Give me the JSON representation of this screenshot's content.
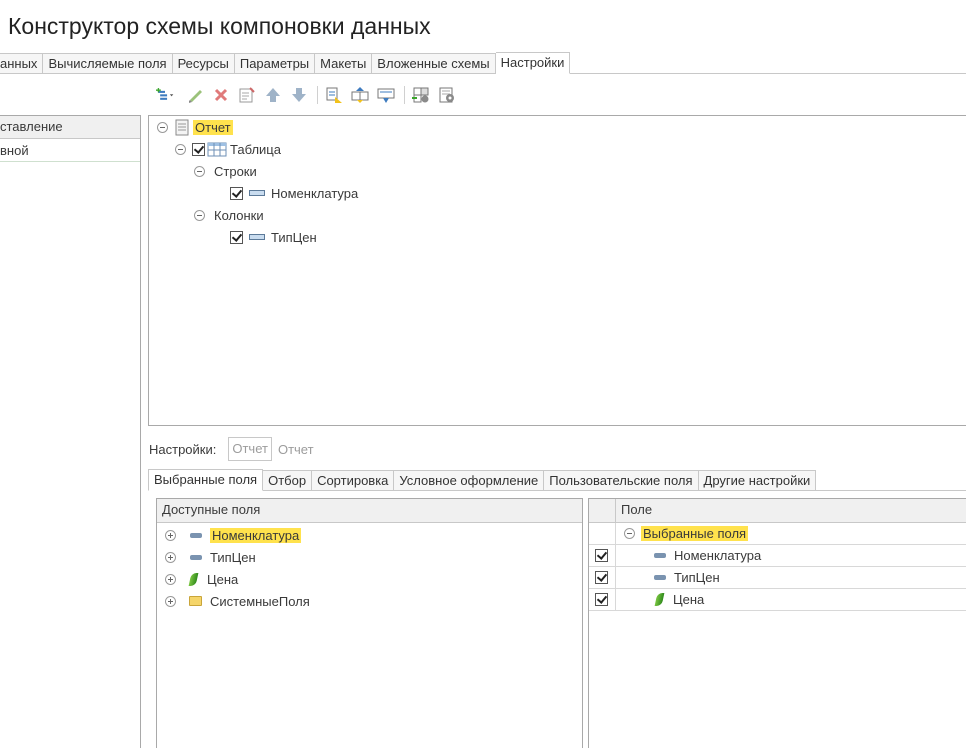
{
  "window": {
    "title": "Конструктор схемы компоновки данных"
  },
  "top_tabs": [
    {
      "label": "анных"
    },
    {
      "label": "Вычисляемые поля"
    },
    {
      "label": "Ресурсы"
    },
    {
      "label": "Параметры"
    },
    {
      "label": "Макеты"
    },
    {
      "label": "Вложенные схемы"
    },
    {
      "label": "Настройки",
      "active": true
    }
  ],
  "toolbar": {
    "icons": [
      "add-element-icon",
      "edit-icon",
      "delete-icon",
      "properties-icon",
      "move-up-icon",
      "move-down-icon",
      "group-1-icon",
      "group-2-icon",
      "group-3-icon",
      "settings-1-icon",
      "settings-2-icon"
    ]
  },
  "left_panel": {
    "header": "ставление",
    "rows": [
      {
        "label": "вной"
      }
    ]
  },
  "structure_tree": {
    "nodes": [
      {
        "label": "Отчет",
        "highlight": true
      },
      {
        "label": "Таблица",
        "checked": true
      },
      {
        "label": "Строки"
      },
      {
        "label": "Номенклатура",
        "checked": true
      },
      {
        "label": "Колонки"
      },
      {
        "label": "ТипЦен",
        "checked": true
      }
    ]
  },
  "settings_line": {
    "label": "Настройки:",
    "button": "Отчет",
    "value": "Отчет"
  },
  "bottom_tabs": [
    {
      "label": "Выбранные поля",
      "active": true
    },
    {
      "label": "Отбор"
    },
    {
      "label": "Сортировка"
    },
    {
      "label": "Условное оформление"
    },
    {
      "label": "Пользовательские поля"
    },
    {
      "label": "Другие настройки"
    }
  ],
  "available_fields": {
    "header": "Доступные поля",
    "items": [
      {
        "label": "Номенклатура",
        "icon": "field-icon",
        "highlight": true
      },
      {
        "label": "ТипЦен",
        "icon": "field-icon"
      },
      {
        "label": "Цена",
        "icon": "resource-icon"
      },
      {
        "label": "СистемныеПоля",
        "icon": "folder-icon"
      }
    ]
  },
  "selected_fields": {
    "header": "Поле",
    "group": "Выбранные поля",
    "items": [
      {
        "label": "Номенклатура",
        "checked": true
      },
      {
        "label": "ТипЦен",
        "checked": true
      },
      {
        "label": "Цена",
        "checked": true
      }
    ]
  }
}
